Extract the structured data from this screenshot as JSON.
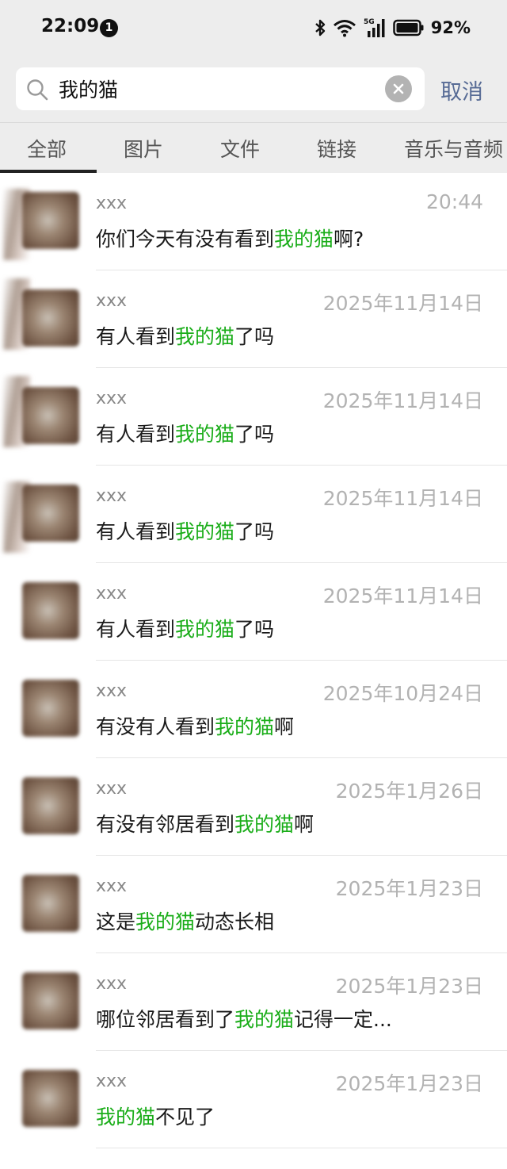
{
  "status_bar": {
    "time": "22:09",
    "notification_count": "1",
    "network": "5G",
    "battery": "92%"
  },
  "search": {
    "query": "我的猫",
    "cancel_label": "取消"
  },
  "tabs": [
    {
      "label": "全部",
      "active": true
    },
    {
      "label": "图片",
      "active": false
    },
    {
      "label": "文件",
      "active": false
    },
    {
      "label": "链接",
      "active": false
    },
    {
      "label": "音乐与音频",
      "active": false
    }
  ],
  "highlight_color": "#1aad19",
  "results": [
    {
      "sender": "xxx",
      "time": "20:44",
      "before": "你们今天有没有看到",
      "match": "我的猫",
      "after": "啊?"
    },
    {
      "sender": "xxx",
      "time": "2025年11月14日",
      "before": "有人看到",
      "match": "我的猫",
      "after": "了吗"
    },
    {
      "sender": "xxx",
      "time": "2025年11月14日",
      "before": "有人看到",
      "match": "我的猫",
      "after": "了吗"
    },
    {
      "sender": "xxx",
      "time": "2025年11月14日",
      "before": "有人看到",
      "match": "我的猫",
      "after": "了吗"
    },
    {
      "sender": "xxx",
      "time": "2025年11月14日",
      "before": "有人看到",
      "match": "我的猫",
      "after": "了吗"
    },
    {
      "sender": "xxx",
      "time": "2025年10月24日",
      "before": "有没有人看到",
      "match": "我的猫",
      "after": "啊"
    },
    {
      "sender": "xxx",
      "time": "2025年1月26日",
      "before": "有没有邻居看到",
      "match": "我的猫",
      "after": "啊"
    },
    {
      "sender": "xxx",
      "time": "2025年1月23日",
      "before": "这是",
      "match": "我的猫",
      "after": "动态长相"
    },
    {
      "sender": "xxx",
      "time": "2025年1月23日",
      "before": "哪位邻居看到了",
      "match": "我的猫",
      "after": "记得一定..."
    },
    {
      "sender": "xxx",
      "time": "2025年1月23日",
      "before": "",
      "match": "我的猫",
      "after": "不见了"
    }
  ]
}
